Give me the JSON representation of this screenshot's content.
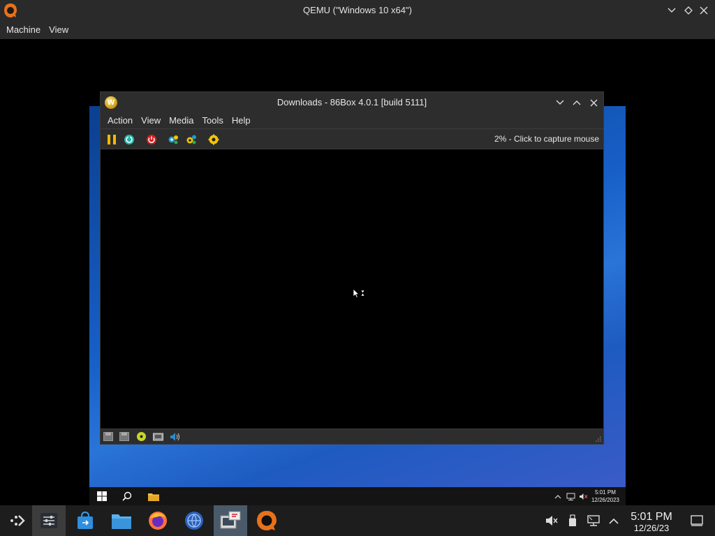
{
  "qemu": {
    "title": "QEMU (\"Windows 10 x64\")",
    "menu": [
      "Machine",
      "View"
    ]
  },
  "box86": {
    "title": "Downloads - 86Box 4.0.1 [build 5111]",
    "menu": [
      "Action",
      "View",
      "Media",
      "Tools",
      "Help"
    ],
    "status_text": "2% - Click to capture mouse",
    "toolbar_icons": [
      "pause-icon",
      "reset-icon",
      "power-icon",
      "settings-icon",
      "discard-icon",
      "cad-icon"
    ],
    "statusbar_icons": [
      "floppy-drive-1-icon",
      "floppy-drive-2-icon",
      "cdrom-icon",
      "network-icon",
      "sound-icon"
    ]
  },
  "guest_taskbar": {
    "time": "5:01 PM",
    "date": "12/26/2023"
  },
  "host_dock": {
    "time": "5:01 PM",
    "date": "12/26/23",
    "apps": [
      "application-launcher",
      "system-settings",
      "discover",
      "dolphin-files",
      "firefox",
      "network-browser",
      "virtual-machine-manager",
      "qemu"
    ]
  },
  "colors": {
    "dark_panel": "#2d2d2d",
    "accent_blue": "#1760c8",
    "qemu_orange": "#e8711a"
  }
}
